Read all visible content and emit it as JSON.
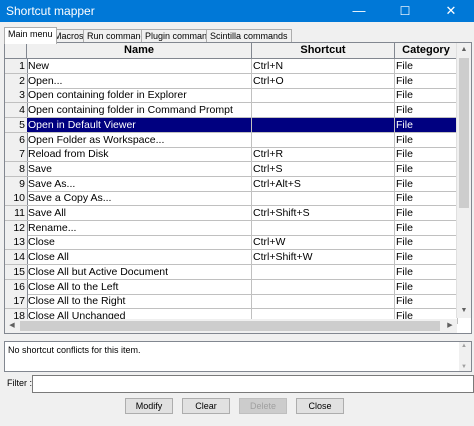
{
  "window": {
    "title": "Shortcut mapper",
    "minimize": "—",
    "maximize": "☐",
    "close": "✕"
  },
  "tabs": [
    {
      "label": "Main menu",
      "active": true
    },
    {
      "label": "Macros"
    },
    {
      "label": "Run commands"
    },
    {
      "label": "Plugin commands"
    },
    {
      "label": "Scintilla commands"
    }
  ],
  "grid": {
    "columns": [
      "Name",
      "Shortcut",
      "Category"
    ],
    "selected_row": 5,
    "rows": [
      {
        "num": "1",
        "name": "New",
        "shortcut": "Ctrl+N",
        "category": "File"
      },
      {
        "num": "2",
        "name": "Open...",
        "shortcut": "Ctrl+O",
        "category": "File"
      },
      {
        "num": "3",
        "name": "Open containing folder in Explorer",
        "shortcut": "",
        "category": "File"
      },
      {
        "num": "4",
        "name": "Open containing folder in Command Prompt",
        "shortcut": "",
        "category": "File"
      },
      {
        "num": "5",
        "name": "Open in Default Viewer",
        "shortcut": "",
        "category": "File"
      },
      {
        "num": "6",
        "name": "Open Folder as Workspace...",
        "shortcut": "",
        "category": "File"
      },
      {
        "num": "7",
        "name": "Reload from Disk",
        "shortcut": "Ctrl+R",
        "category": "File"
      },
      {
        "num": "8",
        "name": "Save",
        "shortcut": "Ctrl+S",
        "category": "File"
      },
      {
        "num": "9",
        "name": "Save As...",
        "shortcut": "Ctrl+Alt+S",
        "category": "File"
      },
      {
        "num": "10",
        "name": "Save a Copy As...",
        "shortcut": "",
        "category": "File"
      },
      {
        "num": "11",
        "name": "Save All",
        "shortcut": "Ctrl+Shift+S",
        "category": "File"
      },
      {
        "num": "12",
        "name": "Rename...",
        "shortcut": "",
        "category": "File"
      },
      {
        "num": "13",
        "name": "Close",
        "shortcut": "Ctrl+W",
        "category": "File"
      },
      {
        "num": "14",
        "name": "Close All",
        "shortcut": "Ctrl+Shift+W",
        "category": "File"
      },
      {
        "num": "15",
        "name": "Close All but Active Document",
        "shortcut": "",
        "category": "File"
      },
      {
        "num": "16",
        "name": "Close All to the Left",
        "shortcut": "",
        "category": "File"
      },
      {
        "num": "17",
        "name": "Close All to the Right",
        "shortcut": "",
        "category": "File"
      },
      {
        "num": "18",
        "name": "Close All Unchanged",
        "shortcut": "",
        "category": "File"
      }
    ]
  },
  "info": {
    "text": "No shortcut conflicts for this item."
  },
  "filter": {
    "label": "Filter :",
    "value": ""
  },
  "buttons": {
    "modify": "Modify",
    "clear": "Clear",
    "delete": "Delete",
    "close": "Close"
  },
  "icons": {
    "scroll_up": "▲",
    "scroll_down": "▼",
    "scroll_left": "◀",
    "scroll_right": "▶"
  }
}
